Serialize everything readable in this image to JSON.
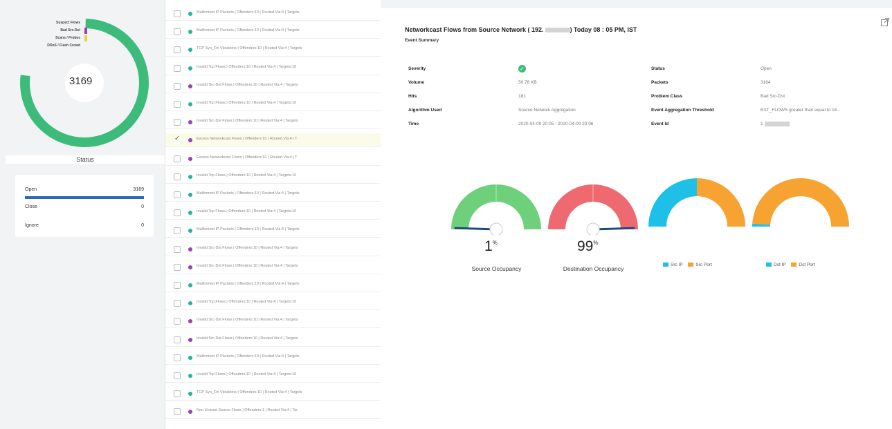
{
  "colors": {
    "donut_green": "#3dbb7b",
    "purple": "#9c3fb6",
    "teal": "#22b59a",
    "bar_blue": "#2a6bb4",
    "gauge_green": "#6fd07b",
    "gauge_red": "#ee6a70",
    "cyan": "#1ec0e8",
    "orange": "#f6a332"
  },
  "donut": {
    "total": "3169",
    "legend": [
      {
        "label": "Suspect Flows",
        "color": "#3dbb7b"
      },
      {
        "label": "Bad Src-Dst",
        "color": "#9c3fb6"
      },
      {
        "label": "Scans / Probes",
        "color": "#f2d23b"
      },
      {
        "label": "DDoS / Flash Crowd",
        "color": "#cccccc"
      }
    ]
  },
  "status": {
    "title": "Status",
    "rows": [
      {
        "label": "Open",
        "value": "3169"
      },
      {
        "label": "Close",
        "value": "0"
      },
      {
        "label": "Ignore",
        "value": "0"
      }
    ]
  },
  "events": [
    {
      "text": "Malformed IP Packets | Offenders:10 | Routed Via:4 | Targets",
      "color": "#22b59a",
      "selected": false
    },
    {
      "text": "Malformed IP Packets | Offenders:10 | Routed Via:4 | Targets",
      "color": "#22b59a",
      "selected": false
    },
    {
      "text": "TCP Syn_Fin Violations | Offenders:10 | Routed Via:4 | Targets",
      "color": "#22b59a",
      "selected": false
    },
    {
      "text": "Invalid Tcp Flows | Offenders:10 | Routed Via:4 | Targets:10",
      "color": "#22b59a",
      "selected": false
    },
    {
      "text": "Invalid Src-Dst Flows | Offenders:10 | Routed Via:4 | Targets",
      "color": "#9c3fb6",
      "selected": false
    },
    {
      "text": "Invalid Tcp Flows | Offenders:10 | Routed Via:4 | Targets:10",
      "color": "#22b59a",
      "selected": false
    },
    {
      "text": "Invalid Src-Dst Flows | Offenders:10 | Routed Via:4 | Targets",
      "color": "#9c3fb6",
      "selected": false
    },
    {
      "text": "Excess Networkcast Flows | Offenders:91 | Routed Via:4 | T",
      "color": "#9c3fb6",
      "selected": true
    },
    {
      "text": "Excess Networkcast Flows | Offenders:91 | Routed Via:4 | T",
      "color": "#9c3fb6",
      "selected": false
    },
    {
      "text": "Invalid Tcp Flows | Offenders:10 | Routed Via:4 | Targets:10",
      "color": "#22b59a",
      "selected": false
    },
    {
      "text": "Malformed IP Packets | Offenders:10 | Routed Via:4 | Targets",
      "color": "#22b59a",
      "selected": false
    },
    {
      "text": "Invalid Tcp Flows | Offenders:10 | Routed Via:4 | Targets:10",
      "color": "#22b59a",
      "selected": false
    },
    {
      "text": "Malformed IP Packets | Offenders:10 | Routed Via:4 | Targets",
      "color": "#22b59a",
      "selected": false
    },
    {
      "text": "Invalid Src-Dst Flows | Offenders:10 | Routed Via:4 | Targets",
      "color": "#9c3fb6",
      "selected": false
    },
    {
      "text": "Invalid Src-Dst Flows | Offenders:10 | Routed Via:4 | Targets",
      "color": "#9c3fb6",
      "selected": false
    },
    {
      "text": "Malformed IP Packets | Offenders:10 | Routed Via:4 | Targets",
      "color": "#22b59a",
      "selected": false
    },
    {
      "text": "Invalid Tcp Flows | Offenders:10 | Routed Via:4 | Targets:10",
      "color": "#22b59a",
      "selected": false
    },
    {
      "text": "Invalid Src-Dst Flows | Offenders:10 | Routed Via:4 | Targets",
      "color": "#9c3fb6",
      "selected": false
    },
    {
      "text": "Invalid Src-Dst Flows | Offenders:10 | Routed Via:4 | Targets",
      "color": "#9c3fb6",
      "selected": false
    },
    {
      "text": "Malformed IP Packets | Offenders:10 | Routed Via:4 | Targets",
      "color": "#22b59a",
      "selected": false
    },
    {
      "text": "Invalid Tcp Flows | Offenders:10 | Routed Via:4 | Targets:10",
      "color": "#22b59a",
      "selected": false
    },
    {
      "text": "TCP Syn_Fin Violations | Offenders:10 | Routed Via:4 | Targets",
      "color": "#22b59a",
      "selected": false
    },
    {
      "text": "Non Unicast Source Flows | Offenders:1 | Routed Via:4 | Tar",
      "color": "#9c3fb6",
      "selected": false
    }
  ],
  "detail": {
    "title_pre": "Networkcast Flows from Source Network ( 192.",
    "title_post": ") Today 08 : 05 PM, IST",
    "subtitle": "Event Summary",
    "left_fields": [
      {
        "key": "Severity",
        "value": ""
      },
      {
        "key": "Volume",
        "value": "50.76 KB"
      },
      {
        "key": "Hits",
        "value": "181"
      },
      {
        "key": "Algorithm Used",
        "value": "Source Network Aggregation"
      },
      {
        "key": "Time",
        "value": "2020-04-09 20:05 - 2020-04-09 20:06"
      }
    ],
    "right_fields": [
      {
        "key": "Status",
        "value": "Open"
      },
      {
        "key": "Packets",
        "value": "3164"
      },
      {
        "key": "Problem Class",
        "value": "Bad Src-Dst"
      },
      {
        "key": "Event Aggregation Threshold",
        "value": "EXT_FLOWS greater than equal to 18..."
      },
      {
        "key": "Event Id",
        "value": "1"
      }
    ]
  },
  "gauges": [
    {
      "pct": "1",
      "pct_sign": "%",
      "label": "Source Occupancy",
      "value": 0.01,
      "color": "#6fd07b"
    },
    {
      "pct": "99",
      "pct_sign": "%",
      "label": "Destination Occupancy",
      "value": 0.99,
      "color": "#ee6a70"
    }
  ],
  "ratio_charts": [
    {
      "split": 0.5,
      "legend": [
        {
          "label": "Src IP",
          "color": "#1ec0e8"
        },
        {
          "label": "Src Port",
          "color": "#f6a332"
        }
      ]
    },
    {
      "split": 0.02,
      "legend": [
        {
          "label": "Dst IP",
          "color": "#1ec0e8"
        },
        {
          "label": "Dst Port",
          "color": "#f6a332"
        }
      ]
    }
  ]
}
